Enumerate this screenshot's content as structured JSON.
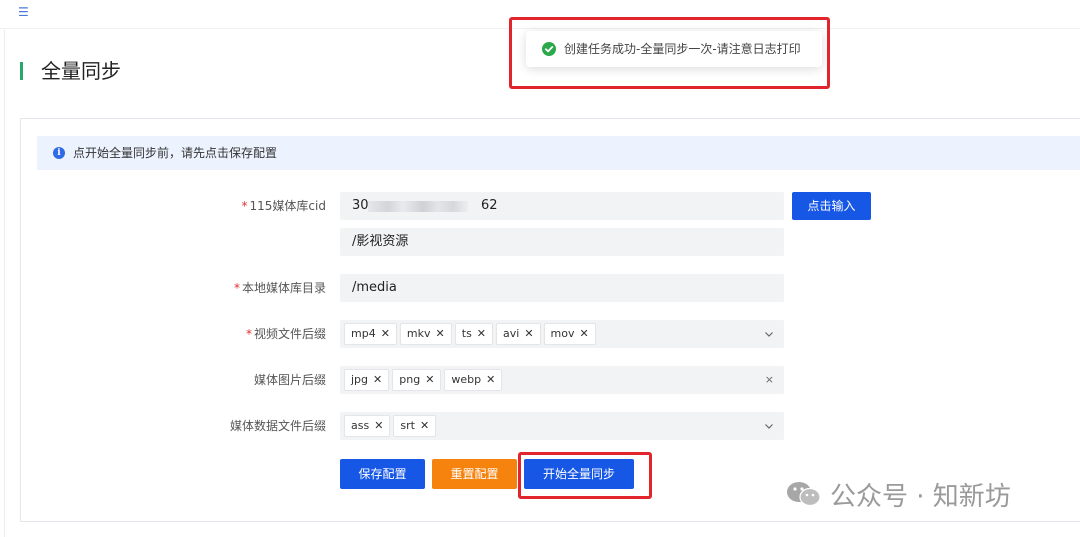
{
  "header": {
    "menu_icon": "menu-fold-icon"
  },
  "page": {
    "title": "全量同步"
  },
  "toast": {
    "message": "创建任务成功-全量同步一次-请注意日志打印",
    "icon": "check-circle-icon",
    "color": "#2ba84a"
  },
  "alert": {
    "text": "点开始全量同步前，请先点击保存配置",
    "icon": "info-icon"
  },
  "form": {
    "cid": {
      "label": "115媒体库cid",
      "value_start": "30",
      "value_end": "62",
      "path": "/影视资源",
      "button": "点击输入"
    },
    "local_dir": {
      "label": "本地媒体库目录",
      "value": "/media"
    },
    "video_ext": {
      "label": "视频文件后缀",
      "tags": [
        "mp4",
        "mkv",
        "ts",
        "avi",
        "mov"
      ],
      "suffix": "⌄"
    },
    "image_ext": {
      "label": "媒体图片后缀",
      "tags": [
        "jpg",
        "png",
        "webp"
      ],
      "suffix": "×"
    },
    "meta_ext": {
      "label": "媒体数据文件后缀",
      "tags": [
        "ass",
        "srt"
      ],
      "suffix": "⌄"
    }
  },
  "buttons": {
    "save": "保存配置",
    "reset": "重置配置",
    "start": "开始全量同步"
  },
  "watermark": {
    "text": "公众号 · 知新坊"
  },
  "colors": {
    "primary": "#1757e6",
    "warning": "#f7830f",
    "highlight": "#e2242c",
    "success": "#2ba84a"
  }
}
